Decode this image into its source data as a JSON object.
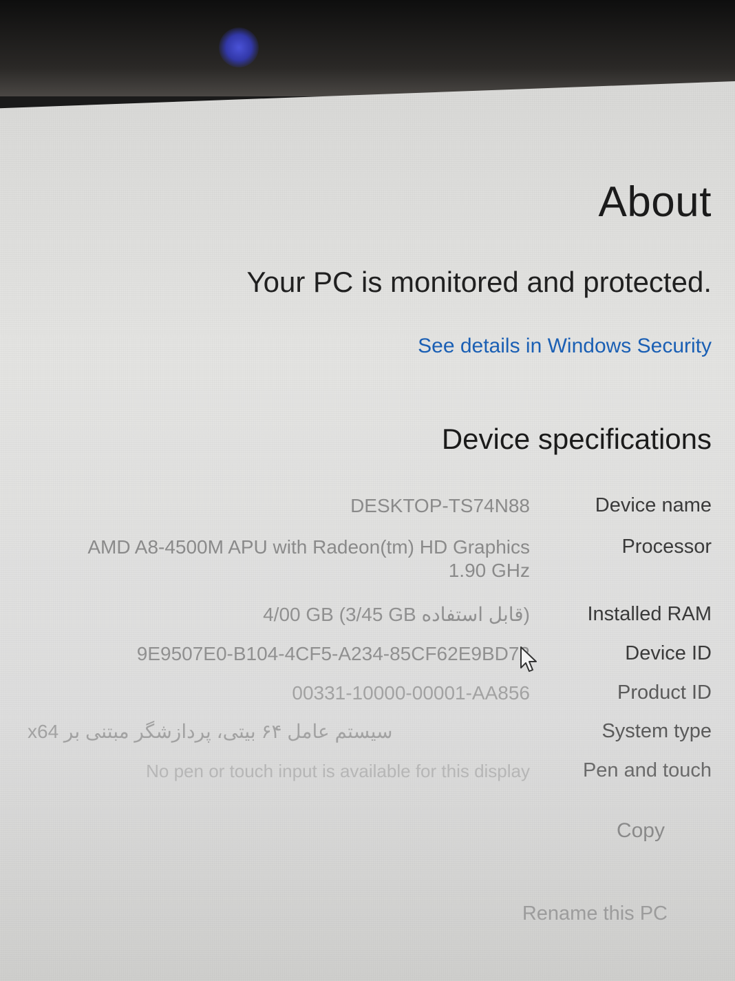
{
  "about": {
    "title": "About",
    "protection_status": "Your PC is monitored and protected.",
    "security_link": "See details in Windows Security"
  },
  "specs": {
    "heading": "Device specifications",
    "rows": [
      {
        "label": "Device name",
        "value": "DESKTOP-TS74N88"
      },
      {
        "label": "Processor",
        "value": "AMD A8-4500M APU with Radeon(tm) HD Graphics",
        "value_line2": "1.90 GHz"
      },
      {
        "label": "Installed RAM",
        "value": "4/00 GB (3/45 GB قابل استفاده)"
      },
      {
        "label": "Device ID",
        "value": "9E9507E0-B104-4CF5-A234-85CF62E9BD72"
      },
      {
        "label": "Product ID",
        "value": "00331-10000-00001-AA856"
      },
      {
        "label": "System type",
        "value": "سیستم عامل ۶۴ بیتی، پردازشگر مبتنی بر x64"
      },
      {
        "label": "Pen and touch",
        "value": "No pen or touch input is available for this display"
      }
    ]
  },
  "actions": {
    "copy": "Copy",
    "rename": "Rename this PC"
  },
  "colors": {
    "link": "#1a5fb4",
    "screen_bg": "#e0e0de",
    "indicator_led": "#3238a8"
  },
  "icons": {
    "cursor": "mouse-pointer-icon",
    "indicator": "webcam-led-icon"
  }
}
